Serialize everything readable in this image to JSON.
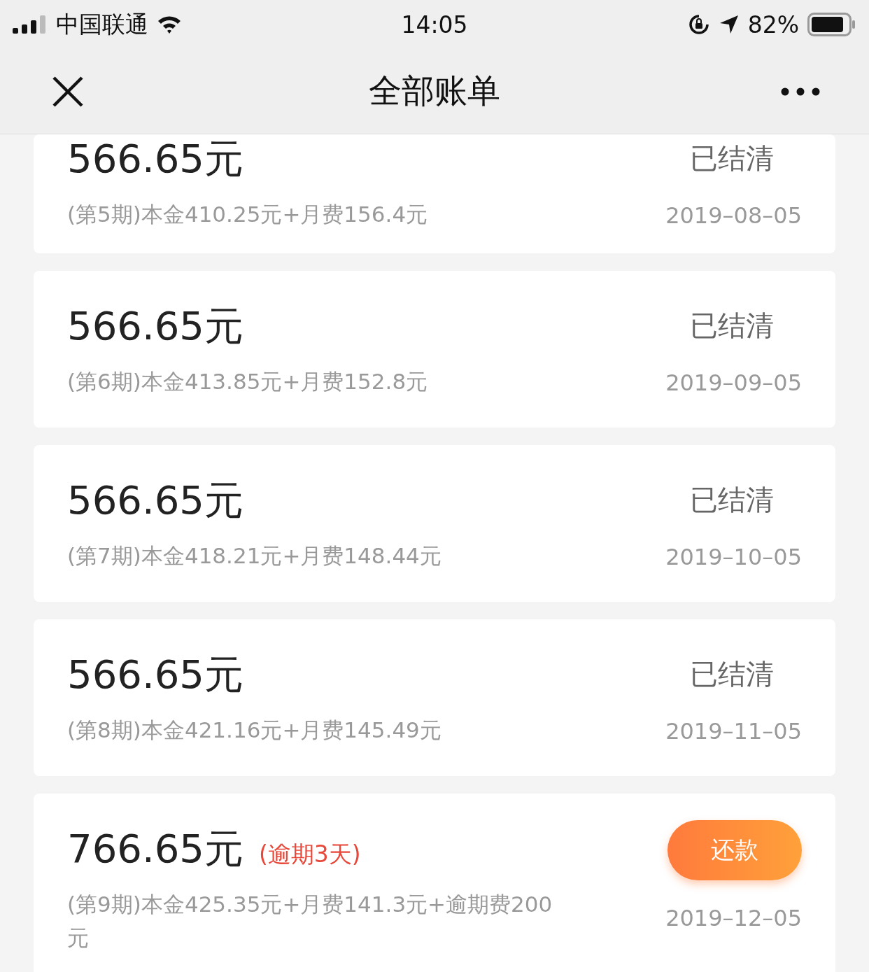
{
  "status_bar": {
    "carrier": "中国联通",
    "time": "14:05",
    "battery": "82%"
  },
  "nav": {
    "title": "全部账单"
  },
  "bills": [
    {
      "kind": "paid",
      "amount": "566.65元",
      "status": "已结清",
      "detail": "(第5期)本金410.25元+月费156.4元",
      "date": "2019–08–05"
    },
    {
      "kind": "paid",
      "amount": "566.65元",
      "status": "已结清",
      "detail": "(第6期)本金413.85元+月费152.8元",
      "date": "2019–09–05"
    },
    {
      "kind": "paid",
      "amount": "566.65元",
      "status": "已结清",
      "detail": "(第7期)本金418.21元+月费148.44元",
      "date": "2019–10–05"
    },
    {
      "kind": "paid",
      "amount": "566.65元",
      "status": "已结清",
      "detail": "(第8期)本金421.16元+月费145.49元",
      "date": "2019–11–05"
    },
    {
      "kind": "overdue",
      "amount": "766.65元",
      "note": "(逾期3天)",
      "button": "还款",
      "detail": "(第9期)本金425.35元+月费141.3元+逾期费200元",
      "date": "2019–12–05"
    }
  ]
}
